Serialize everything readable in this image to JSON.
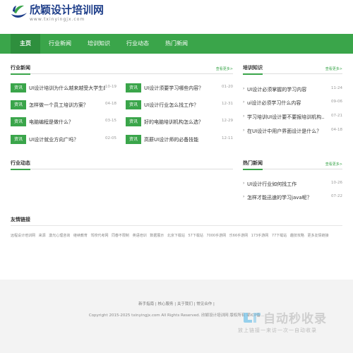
{
  "logo": {
    "title": "欣颖设计培训网",
    "url": "www.txinyingjx.com"
  },
  "nav": [
    {
      "label": "主页",
      "active": true
    },
    {
      "label": "行业新闻"
    },
    {
      "label": "培训知识"
    },
    {
      "label": "行业动态"
    },
    {
      "label": "热门新闻"
    }
  ],
  "industry_news": {
    "title": "行业新闻",
    "more": "查看更多>",
    "badge": "资讯",
    "left": [
      {
        "text": "UI设计培训为什么越来越受大学生的...",
        "date": "10-19"
      },
      {
        "text": "怎样做一个员工培训方案？",
        "date": "04-18"
      },
      {
        "text": "电脑编程是做什么？",
        "date": "03-15"
      },
      {
        "text": "UI设计就业方向广吗？",
        "date": "02-05"
      }
    ],
    "right": [
      {
        "text": "UI设计须要学习哪些内容？",
        "date": "01-20"
      },
      {
        "text": "UI设计行业怎么找工作？",
        "date": "12-31"
      },
      {
        "text": "好的电脑培训机构怎么选？",
        "date": "12-29"
      },
      {
        "text": "高薪UI设计师的必备技能",
        "date": "12-11"
      }
    ]
  },
  "training": {
    "title": "培训知识",
    "more": "查看更多>",
    "items": [
      {
        "text": "UI设计必须掌握的学习内容",
        "date": "11-24"
      },
      {
        "text": "ui设计必须学习什么内容",
        "date": "09-06"
      },
      {
        "text": "学习培训UI设计要不要报培训机构...",
        "date": "07-21"
      },
      {
        "text": "在UI设计中用户界面设计是什么？",
        "date": "04-18"
      }
    ]
  },
  "industry_trends": {
    "title": "行业动态"
  },
  "hot_news": {
    "title": "热门新闻",
    "more": "查看更多>",
    "items": [
      {
        "text": "UI设计行业如何找工作",
        "date": "10-26"
      },
      {
        "text": "怎样才能迅速的学习java呢？",
        "date": "07-22"
      }
    ]
  },
  "friend_links": {
    "title": "友情链接",
    "items": [
      "远程设计培训网",
      "来源",
      "激光心理咨询",
      "继续教育",
      "驾校代考网",
      "同春不限制",
      "英语培训",
      "数据展示",
      "北京下载站",
      "57下载站",
      "7000手游网",
      "乐66手游网",
      "173手游网",
      "77下载站",
      "趣技攻略",
      "更多友情链接"
    ]
  },
  "footer": {
    "links": "新手指南 | 核心服务 | 关于我们 | 常见合作 |",
    "copyright": "Copyright 2015-2025 txinyingjx.com All Rights Reserved. 欣颖设计培训网 版权所有 鄂ICP备..."
  },
  "watermark": {
    "title": "自动秒收录",
    "sub": "放上链接一来访一次一自动收录"
  },
  "colors": {
    "accent": "#3aa54a",
    "nav_active": "#2e8f3d",
    "logo_blue": "#1f3f8a"
  }
}
